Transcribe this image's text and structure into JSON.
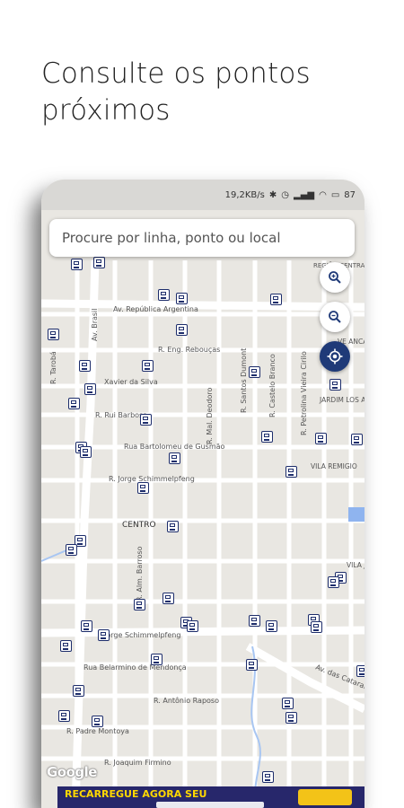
{
  "headline": "Consulte os pontos próximos",
  "status_bar": {
    "network_speed": "19,2KB/s",
    "battery": "87"
  },
  "search": {
    "placeholder": "Procure por linha, ponto ou local"
  },
  "map": {
    "labels": {
      "av_republica_argentina": "Av. República Argentina",
      "r_eng_reboucas": "R. Eng. Rebouças",
      "xavier_da_silva": "Xavier da Silva",
      "r_rui_barbosa": "R. Rui Barbosa",
      "rua_bartolomeu": "Rua Bartolomeu de Gusmão",
      "r_jorge_schimmelpfeng_top": "R. Jorge Schimmelpfeng",
      "centro": "CENTRO",
      "jorge_schimmelpfeng": "Jorge Schimmelpfeng",
      "rua_belarmino": "Rua Belarmino de Mendonça",
      "r_antonio_raposo": "R. Antônio Raposo",
      "r_padre_montoya": "R. Padre Montoya",
      "r_joaquim_firmino": "R. Joaquim Firmino",
      "r_mal_deodoro": "R. Mal. Deodoro",
      "r_santos_dumont": "R. Santos Dumont",
      "r_castelo_branco": "R. Castelo Branco",
      "r_petrolina": "R. Petrolina Vieira Cirilo",
      "jardim_los_angeles": "JARDIM LOS ANGELES",
      "vila_remigio": "VILA REMIGIO",
      "regiao_central": "REGIÃO CENTRAL",
      "av_brasil": "Av. Brasil",
      "r_alm_barroso": "R. Alm. Barroso",
      "r_tarobá": "R. Tarobá",
      "vila_ju": "VILA JU",
      "av_das_cataratas": "Av. das Cataratas",
      "ve_anca": "VE ANCA"
    }
  },
  "google_logo": "Google",
  "banner": {
    "text": "RECARREGUE AGORA SEU"
  },
  "icons": {
    "zoom_in": "zoom-in-icon",
    "zoom_out": "zoom-out-icon",
    "locate": "my-location-icon",
    "stop": "bus-stop-icon"
  },
  "colors": {
    "accent": "#1f3a78",
    "stop": "#1d2d6b",
    "banner": "#27276b",
    "banner_text": "#ffd800"
  }
}
